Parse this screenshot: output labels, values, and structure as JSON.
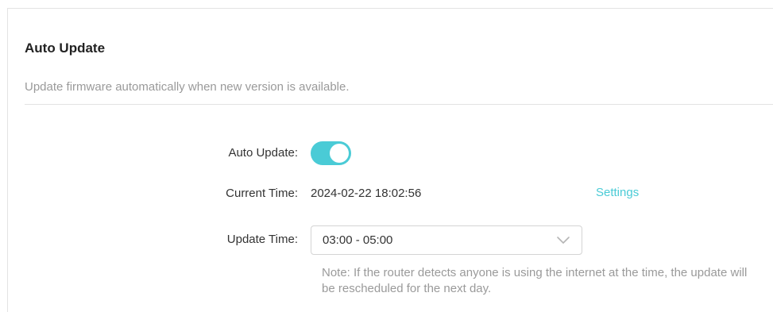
{
  "section": {
    "title": "Auto Update",
    "description": "Update firmware automatically when new version is available."
  },
  "auto_update": {
    "label": "Auto Update:",
    "enabled": true
  },
  "current_time": {
    "label": "Current Time:",
    "value": "2024-02-22 18:02:56",
    "settings_link": "Settings"
  },
  "update_time": {
    "label": "Update Time:",
    "selected": "03:00 - 05:00"
  },
  "note": "Note: If the router detects anyone is using the internet at the time, the update will be rescheduled for the next day.",
  "colors": {
    "accent": "#4acbd6",
    "muted_text": "#9a9a9a",
    "text": "#333333"
  },
  "icons": {
    "dropdown": "chevron-down-icon"
  }
}
